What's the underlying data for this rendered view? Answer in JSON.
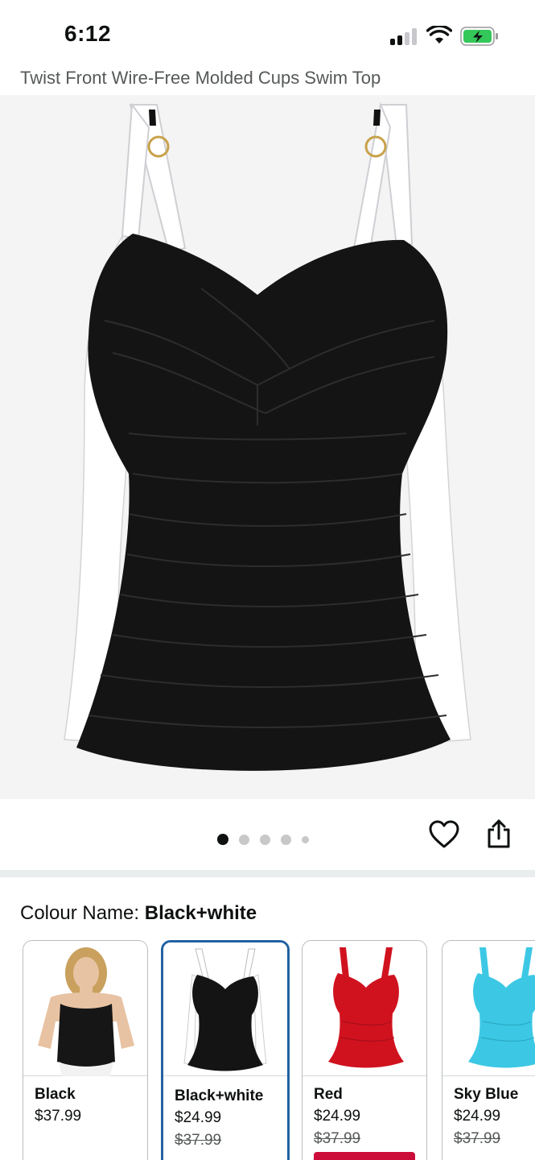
{
  "status_bar": {
    "time": "6:12"
  },
  "product": {
    "title": "Twist Front Wire-Free Molded Cups Swim Top"
  },
  "gallery": {
    "image_count": 5,
    "active_index": 0
  },
  "colour": {
    "label": "Colour Name: ",
    "selected_value": "Black+white"
  },
  "swatches": [
    {
      "name": "Black",
      "price": "$37.99",
      "was_price": "",
      "color": "#1a1a1a"
    },
    {
      "name": "Black+white",
      "price": "$24.99",
      "was_price": "$37.99",
      "color": "#1a1a1a"
    },
    {
      "name": "Red",
      "price": "$24.99",
      "was_price": "$37.99",
      "color": "#d0121f"
    },
    {
      "name": "Sky Blue",
      "price": "$24.99",
      "was_price": "$37.99",
      "color": "#3cc8e4"
    }
  ],
  "colors": {
    "selected_border": "#2162a1",
    "deal_badge": "#cc0c39",
    "battery_fill": "#34c759"
  },
  "icons": {
    "heart": "heart-icon",
    "share": "share-icon",
    "signal": "signal-icon",
    "wifi": "wifi-icon",
    "battery": "battery-charging-icon"
  }
}
